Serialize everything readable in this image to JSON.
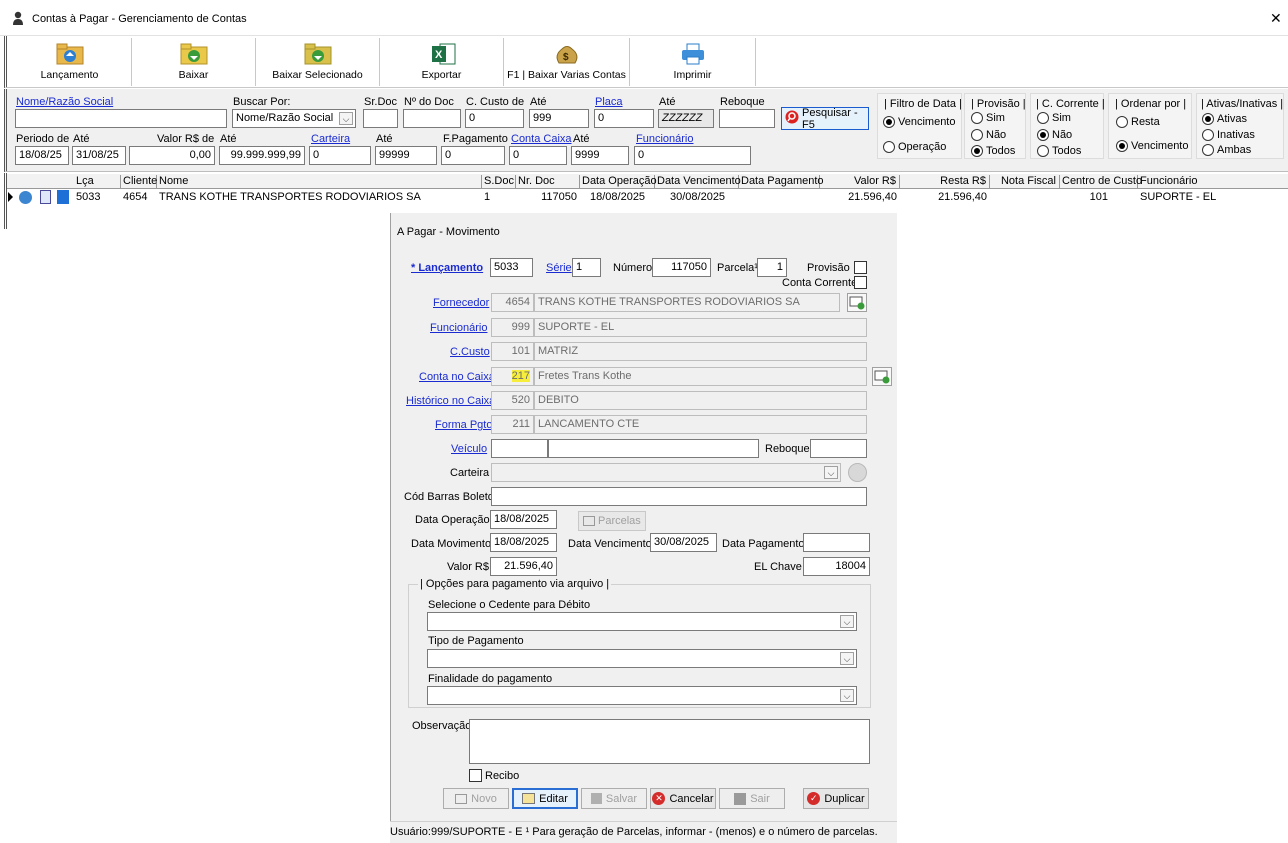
{
  "window": {
    "title": "Contas à Pagar - Gerenciamento de Contas",
    "close": "✕"
  },
  "toolbar": {
    "lancamento": "Lançamento",
    "baixar": "Baixar",
    "baixar_sel": "Baixar Selecionado",
    "exportar": "Exportar",
    "varias": "F1 | Baixar Varias Contas",
    "imprimir": "Imprimir"
  },
  "filters": {
    "nome_label": "Nome/Razão Social",
    "nome_value": "",
    "buscar_label": "Buscar Por:",
    "buscar_value": "Nome/Razão Social",
    "srdoc_label": "Sr.Doc",
    "srdoc_value": "",
    "ndoc_label": "Nº do Doc",
    "ndoc_value": "",
    "ccusto_label": "C. Custo de",
    "ccusto_value": "0",
    "ate_label": "Até",
    "ccusto_ate": "999",
    "placa_label": "Placa",
    "placa_value": "0",
    "placa_ate": "ZZZZZZ",
    "reboque_label": "Reboque",
    "reboque_value": "",
    "pesquisar": "Pesquisar - F5",
    "periodo_label": "Periodo de",
    "periodo_de": "18/08/25",
    "periodo_ate": "31/08/25",
    "valor_label": "Valor R$ de",
    "valor_de": "0,00",
    "valor_ate": "99.999.999,99",
    "carteira_label": "Carteira",
    "carteira_de": "0",
    "carteira_ate": "99999",
    "fpag_label": "F.Pagamento",
    "fpag_value": "0",
    "contacaixa_label": "Conta Caixa",
    "contacaixa_de": "0",
    "contacaixa_ate": "9999",
    "funcionario_label": "Funcionário",
    "funcionario_value": "0"
  },
  "groups": {
    "data_title": "| Filtro de Data |",
    "data_opts": [
      "Vencimento",
      "Operação"
    ],
    "prov_title": "| Provisão |",
    "prov_opts": [
      "Sim",
      "Não",
      "Todos"
    ],
    "cc_title": "| C. Corrente |",
    "cc_opts": [
      "Sim",
      "Não",
      "Todos"
    ],
    "ord_title": "| Ordenar por |",
    "ord_opts": [
      "Resta",
      "Vencimento"
    ],
    "ativ_title": "| Ativas/Inativas |",
    "ativ_opts": [
      "Ativas",
      "Inativas",
      "Ambas"
    ]
  },
  "grid": {
    "headers": [
      "Lça",
      "Cliente",
      "Nome",
      "S.Doc",
      "Nr. Doc",
      "Data Operação",
      "Data Vencimento",
      "Data Pagamento",
      "Valor R$",
      "Resta R$",
      "Nota Fiscal",
      "Centro de Custo",
      "Funcionário"
    ],
    "row": [
      "5033",
      "4654",
      "TRANS KOTHE TRANSPORTES RODOVIARIOS SA",
      "1",
      "117050",
      "18/08/2025",
      "30/08/2025",
      "",
      "21.596,40",
      "21.596,40",
      "",
      "101",
      "SUPORTE - EL"
    ]
  },
  "dialog": {
    "title": "A Pagar - Movimento",
    "lancamento_label": "* Lançamento",
    "lancamento_value": "5033",
    "serie_label": "Série",
    "serie_value": "1",
    "numero_label": "Número",
    "numero_value": "117050",
    "parcela_label": "Parcela¹",
    "parcela_value": "1",
    "provisao_label": "Provisão",
    "cc_label": "Conta Corrente",
    "fornecedor_label": "Fornecedor",
    "fornecedor_code": "4654",
    "fornecedor_name": "TRANS KOTHE TRANSPORTES RODOVIARIOS SA",
    "funcionario_label": "Funcionário",
    "funcionario_code": "999",
    "funcionario_name": "SUPORTE - EL",
    "ccusto_label": "C.Custo",
    "ccusto_code": "101",
    "ccusto_name": "MATRIZ",
    "contacaixa_label": "Conta no Caixa",
    "contacaixa_code": "217",
    "contacaixa_name": "Fretes Trans Kothe",
    "historico_label": "Histórico no Caixa",
    "historico_code": "520",
    "historico_name": "DEBITO",
    "forma_label": "Forma Pgto",
    "forma_code": "211",
    "forma_name": "LANCAMENTO CTE",
    "veiculo_label": "Veículo",
    "reboque_label": "Reboque",
    "carteira_label": "Carteira",
    "codbarras_label": "Cód Barras Boleto",
    "dataop_label": "Data Operação",
    "dataop_value": "18/08/2025",
    "parcelas_btn": "Parcelas",
    "datamov_label": "Data Movimento",
    "datamov_value": "18/08/2025",
    "datavenc_label": "Data Vencimento",
    "datavenc_value": "30/08/2025",
    "datapag_label": "Data Pagamento",
    "datapag_value": "",
    "valor_label": "Valor R$",
    "valor_value": "21.596,40",
    "elchave_label": "EL Chave",
    "elchave_value": "18004",
    "opcoes_title": "| Opções para pagamento via arquivo |",
    "cedente_label": "Selecione o Cedente para Débito",
    "tipo_label": "Tipo de Pagamento",
    "finalidade_label": "Finalidade do pagamento",
    "obs_label": "Observação",
    "recibo_label": "Recibo",
    "btn_novo": "Novo",
    "btn_editar": "Editar",
    "btn_salvar": "Salvar",
    "btn_cancelar": "Cancelar",
    "btn_sair": "Sair",
    "btn_duplicar": "Duplicar",
    "status": "Usuário:999/SUPORTE - E ¹ Para geração de Parcelas, informar - (menos) e o número de parcelas."
  }
}
